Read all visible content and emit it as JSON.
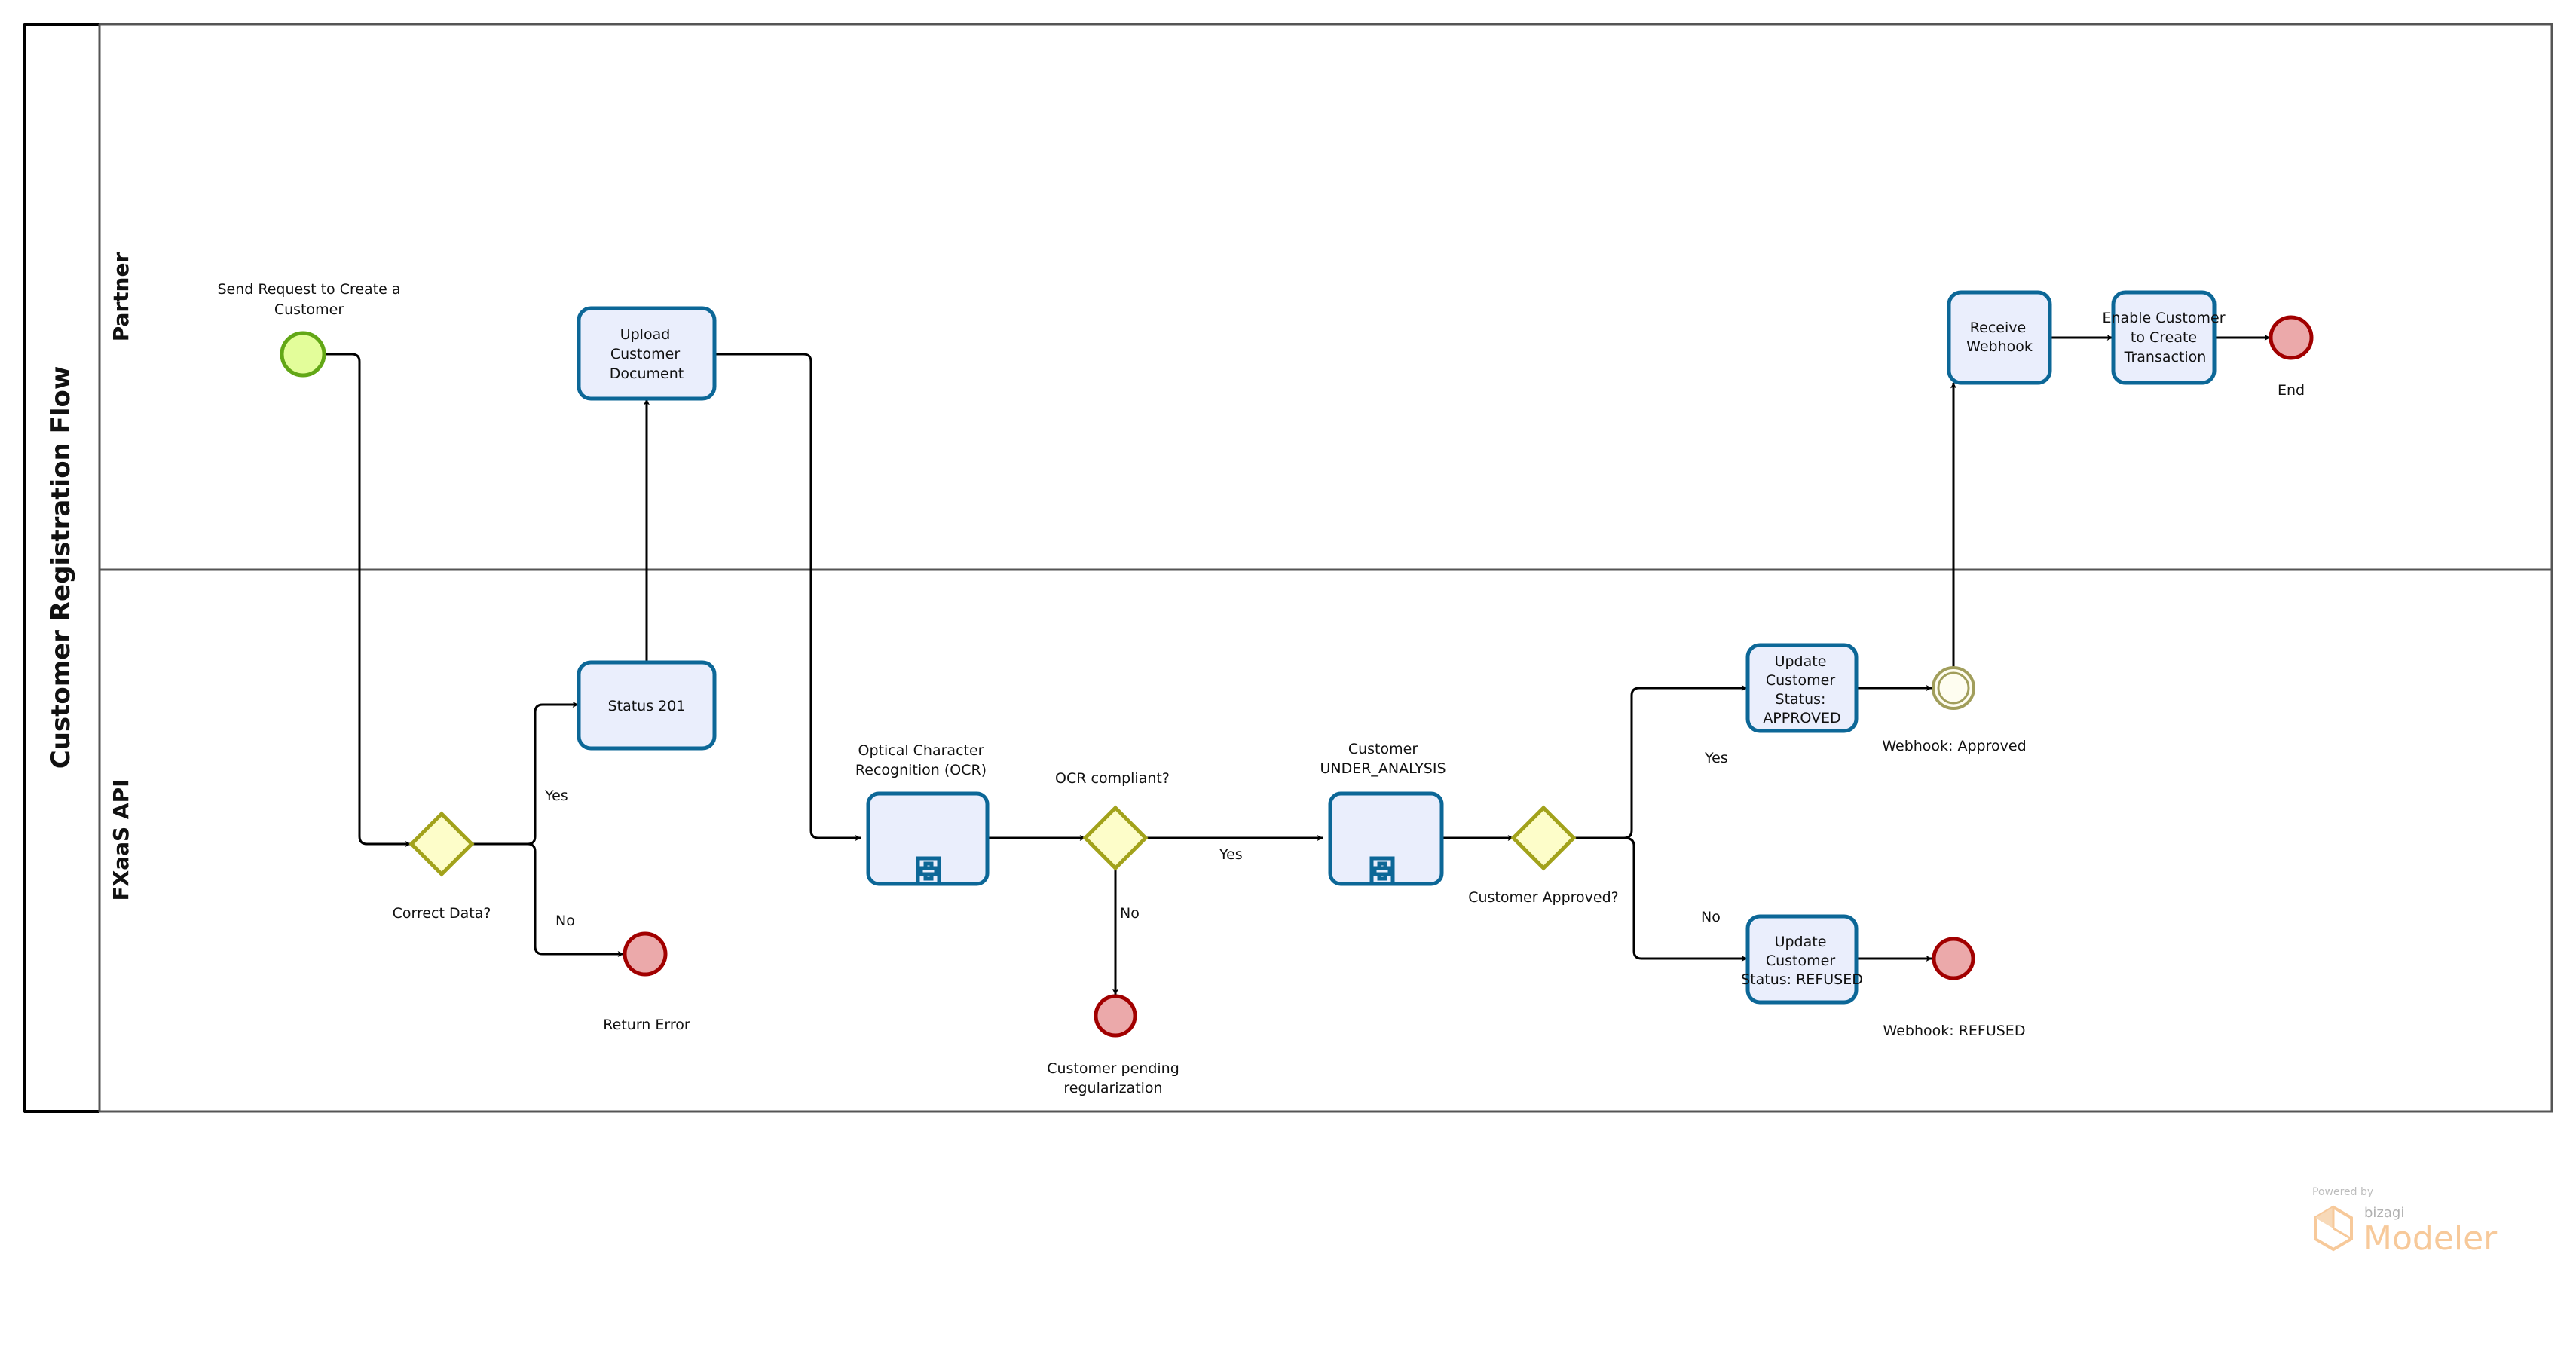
{
  "pool": {
    "title": "Customer Registration Flow"
  },
  "lanes": [
    {
      "id": "partner",
      "label": "Partner"
    },
    {
      "id": "fxaas",
      "label": "FXaaS API"
    }
  ],
  "events": {
    "start": {
      "label_lines": [
        "Send Request to Create a",
        "Customer"
      ],
      "type": "start"
    },
    "return_error": {
      "label_lines": [
        "Return Error"
      ],
      "type": "end"
    },
    "pending": {
      "label_lines": [
        "Customer pending",
        "regularization"
      ],
      "type": "end"
    },
    "webhook_approved": {
      "label_lines": [
        "Webhook: Approved"
      ],
      "type": "intermediate"
    },
    "webhook_refused": {
      "label_lines": [
        "Webhook: REFUSED"
      ],
      "type": "end"
    },
    "end": {
      "label_lines": [
        "End"
      ],
      "type": "end"
    }
  },
  "tasks": {
    "upload": {
      "lines": [
        "Upload",
        "Customer",
        "Document"
      ]
    },
    "status201": {
      "lines": [
        "Status 201"
      ]
    },
    "ocr": {
      "label_lines": [
        "Optical Character",
        "Recognition (OCR)"
      ],
      "subprocess": true
    },
    "analysis": {
      "label_lines": [
        "Customer",
        "UNDER_ANALYSIS"
      ],
      "subprocess": true
    },
    "approved": {
      "lines": [
        "Update",
        "Customer",
        "Status:",
        "APPROVED"
      ]
    },
    "refused": {
      "lines": [
        "Update",
        "Customer",
        "Status: REFUSED"
      ]
    },
    "receive": {
      "lines": [
        "Receive",
        "Webhook"
      ]
    },
    "enable": {
      "lines": [
        "Enable Customer",
        "to Create",
        "Transaction"
      ]
    }
  },
  "gateways": {
    "correct_data": {
      "label": "Correct Data?"
    },
    "ocr_compliant": {
      "label": "OCR compliant?"
    },
    "approved": {
      "label": "Customer Approved?"
    }
  },
  "flow_labels": {
    "correct_yes": "Yes",
    "correct_no": "No",
    "ocr_yes": "Yes",
    "ocr_no": "No",
    "approved_yes": "Yes",
    "approved_no": "No"
  },
  "watermark": {
    "powered_by": "Powered by",
    "brand": "bizagi",
    "product": "Modeler"
  },
  "colors": {
    "task_fill": "#eaeefc",
    "task_stroke": "#0c6797",
    "start_fill": "#e3fd9a",
    "start_stroke": "#62a716",
    "end_fill": "#eba9aa",
    "end_stroke": "#a10000",
    "gateway_fill": "#fdfdc9",
    "gateway_stroke": "#a2a21b",
    "intermediate_fill": "#fefdf0",
    "intermediate_stroke": "#a19e5b",
    "watermark": "#f7c99a"
  }
}
